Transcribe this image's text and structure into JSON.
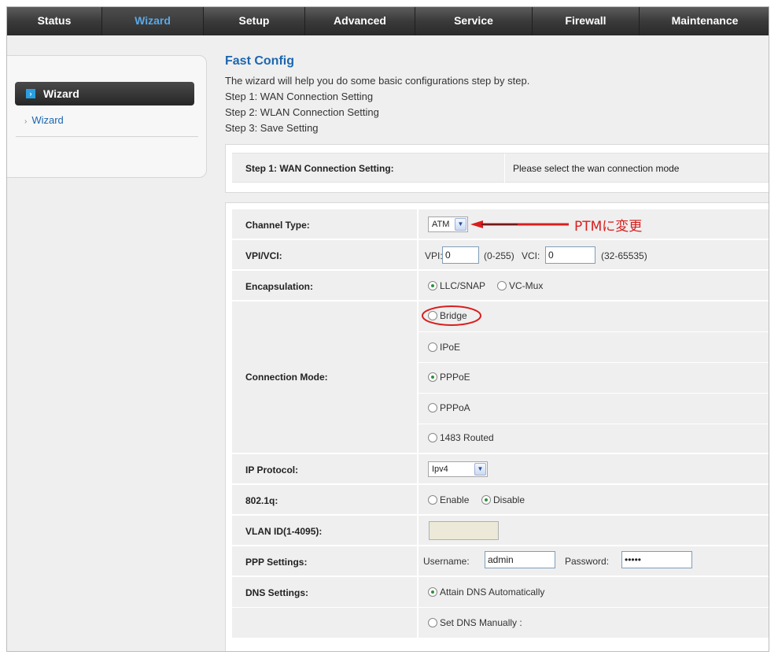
{
  "nav": {
    "tabs": [
      {
        "label": "Status"
      },
      {
        "label": "Wizard"
      },
      {
        "label": "Setup"
      },
      {
        "label": "Advanced"
      },
      {
        "label": "Service"
      },
      {
        "label": "Firewall"
      },
      {
        "label": "Maintenance"
      }
    ],
    "active_index": 1
  },
  "sidebar": {
    "active_label": "Wizard",
    "sub_item_label": "Wizard",
    "bullet_glyph": "›"
  },
  "page": {
    "title": "Fast Config",
    "intro_lines": [
      "The wizard will help you do some basic configurations step by step.",
      "Step 1: WAN Connection Setting",
      "Step 2: WLAN Connection Setting",
      "Step 3: Save Setting"
    ]
  },
  "step": {
    "label": "Step 1: WAN Connection Setting:",
    "message": "Please select the wan connection mode"
  },
  "form": {
    "channel_type": {
      "label": "Channel Type:",
      "value": "ATM"
    },
    "annotation": "PTMに変更",
    "vpi_vci": {
      "label": "VPI/VCI:",
      "vpi_label": "VPI:",
      "vpi_value": "0",
      "vpi_range": "(0-255)",
      "vci_label": "VCI:",
      "vci_value": "0",
      "vci_range": "(32-65535)"
    },
    "encapsulation": {
      "label": "Encapsulation:",
      "options": [
        {
          "label": "LLC/SNAP",
          "selected": true
        },
        {
          "label": "VC-Mux",
          "selected": false
        }
      ]
    },
    "connection_mode": {
      "label": "Connection Mode:",
      "options": [
        {
          "label": "Bridge",
          "selected": false
        },
        {
          "label": "IPoE",
          "selected": false
        },
        {
          "label": "PPPoE",
          "selected": true
        },
        {
          "label": "PPPoA",
          "selected": false
        },
        {
          "label": "1483 Routed",
          "selected": false
        }
      ]
    },
    "ip_protocol": {
      "label": "IP Protocol:",
      "value": "Ipv4"
    },
    "dot1q": {
      "label": "802.1q:",
      "options": [
        {
          "label": "Enable",
          "selected": false
        },
        {
          "label": "Disable",
          "selected": true
        }
      ]
    },
    "vlan_id": {
      "label": "VLAN ID(1-4095):",
      "value": ""
    },
    "ppp": {
      "label": "PPP Settings:",
      "username_label": "Username:",
      "username_value": "admin",
      "password_label": "Password:",
      "password_value": "•••••"
    },
    "dns": {
      "label": "DNS Settings:",
      "options": [
        {
          "label": "Attain DNS Automatically",
          "selected": true
        },
        {
          "label": "Set DNS Manually :",
          "selected": false
        }
      ]
    }
  },
  "colors": {
    "accent_blue": "#1c66b0",
    "active_tab_text": "#59a9e8",
    "annotation_red": "#d81e1e",
    "radio_selected": "#2f8f3f"
  }
}
